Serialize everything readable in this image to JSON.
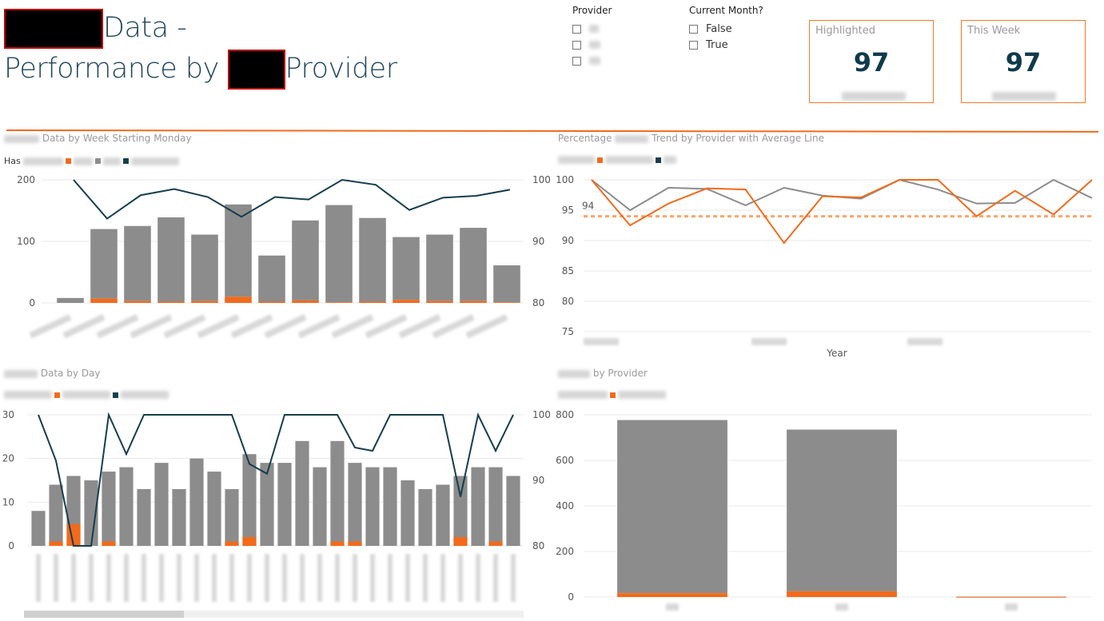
{
  "header": {
    "title_line1_suffix": "Data -",
    "title_line2_prefix": "Performance by",
    "title_line2_suffix": "Provider"
  },
  "slicers": {
    "provider": {
      "label": "Provider"
    },
    "current_month": {
      "label": "Current Month?",
      "options": [
        "False",
        "True"
      ]
    }
  },
  "cards": [
    {
      "label": "Highlighted",
      "value": "97"
    },
    {
      "label": "This Week",
      "value": "97"
    }
  ],
  "visuals": {
    "weekly": {
      "title_suffix": "Data by Week Starting Monday",
      "legend_prefix": "Has",
      "chart_data": {
        "type": "bar",
        "stacked": true,
        "y_left_ticks": [
          "0",
          "100",
          "200"
        ],
        "y_right_ticks": [
          "80",
          "90",
          "100"
        ],
        "ylim_left": [
          0,
          200
        ],
        "ylim_right": [
          80,
          100
        ],
        "gray": [
          8,
          113,
          122,
          137,
          108,
          150,
          75,
          130,
          158,
          136,
          102,
          108,
          119,
          60
        ],
        "orange": [
          0,
          7,
          3,
          2,
          3,
          10,
          2,
          4,
          1,
          2,
          5,
          3,
          3,
          1
        ],
        "line": [
          null,
          100,
          93.7,
          97.5,
          98.5,
          97.2,
          94.0,
          97.2,
          96.8,
          100,
          99.2,
          95.1,
          97.1,
          97.4,
          98.4
        ]
      }
    },
    "trend": {
      "title_prefix": "Percentage",
      "title_suffix": "Trend by Provider with Average Line",
      "chart_data": {
        "type": "line",
        "xlabel": "Year",
        "y_ticks": [
          "75",
          "80",
          "85",
          "90",
          "95",
          "100"
        ],
        "ylim": [
          75,
          100
        ],
        "avg_label": "94",
        "avg": 94,
        "gray": [
          100,
          95.0,
          98.7,
          98.5,
          95.8,
          98.7,
          97.4,
          96.9,
          100,
          98.4,
          96.1,
          96.2,
          100,
          97.0
        ],
        "orange": [
          100,
          92.5,
          96.1,
          98.6,
          98.4,
          89.6,
          97.3,
          97.1,
          100,
          100,
          94.0,
          98.2,
          94.3,
          100
        ]
      }
    },
    "daily": {
      "title_suffix": "Data by Day",
      "chart_data": {
        "type": "bar",
        "stacked": true,
        "y_left_ticks": [
          "0",
          "10",
          "20",
          "30"
        ],
        "y_right_ticks": [
          "80",
          "90",
          "100"
        ],
        "ylim_left": [
          0,
          30
        ],
        "ylim_right": [
          80,
          100
        ],
        "gray": [
          8,
          14,
          16,
          15,
          17,
          18,
          13,
          19,
          13,
          20,
          17,
          13,
          21,
          19,
          19,
          24,
          18,
          24,
          19,
          18,
          18,
          15,
          13,
          14,
          16,
          18,
          18,
          16
        ],
        "orange": [
          0,
          1,
          5,
          0,
          1,
          0,
          0,
          0,
          0,
          0,
          0,
          1,
          2,
          0,
          0,
          0,
          0,
          1,
          1,
          0,
          0,
          0,
          0,
          0,
          2,
          0,
          1,
          0
        ],
        "line": [
          100,
          93,
          80,
          80,
          100,
          94,
          100,
          100,
          100,
          100,
          100,
          100,
          92.5,
          91,
          100,
          100,
          100,
          100,
          95,
          94.5,
          100,
          100,
          100,
          100,
          87.5,
          100,
          94.5,
          100
        ]
      }
    },
    "provider": {
      "title_suffix": "by Provider",
      "chart_data": {
        "type": "bar",
        "stacked": true,
        "y_ticks": [
          "0",
          "200",
          "400",
          "600",
          "800"
        ],
        "ylim": [
          0,
          800
        ],
        "gray": [
          760,
          710,
          1
        ],
        "orange": [
          17,
          25,
          1
        ]
      }
    }
  },
  "colors": {
    "orange": "#f26a1b",
    "gray": "#8c8c8c",
    "navy": "#153e4d",
    "trend_gray": "#8c8c8c",
    "accent_line": "#f26a1b"
  }
}
